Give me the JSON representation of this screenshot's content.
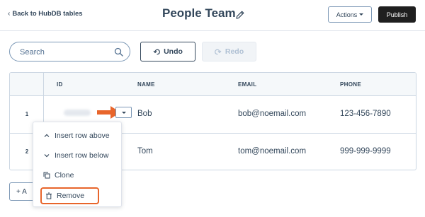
{
  "header": {
    "back_label": "Back to HubDB tables",
    "back_chevron": "‹",
    "title": "People Team",
    "actions_label": "Actions",
    "publish_label": "Publish"
  },
  "toolbar": {
    "search_placeholder": "Search",
    "undo_label": "Undo",
    "redo_label": "Redo"
  },
  "table": {
    "columns": [
      "ID",
      "NAME",
      "EMAIL",
      "PHONE"
    ],
    "rows": [
      {
        "index": "1",
        "name": "Bob",
        "email": "bob@noemail.com",
        "phone": "123-456-7890"
      },
      {
        "index": "2",
        "name": "Tom",
        "email": "tom@noemail.com",
        "phone": "999-999-9999"
      }
    ]
  },
  "row_menu": {
    "items": [
      {
        "label": "Insert row above",
        "icon": "chevron-up-icon"
      },
      {
        "label": "Insert row below",
        "icon": "chevron-down-icon"
      },
      {
        "label": "Clone",
        "icon": "clone-icon"
      },
      {
        "label": "Remove",
        "icon": "trash-icon"
      }
    ]
  },
  "add_button": {
    "label": "+ A"
  },
  "colors": {
    "text": "#33475b",
    "border": "#cbd6e2",
    "header_bg": "#f5f8fa",
    "publish_bg": "#1f1f1f",
    "highlight": "#e8652b"
  }
}
